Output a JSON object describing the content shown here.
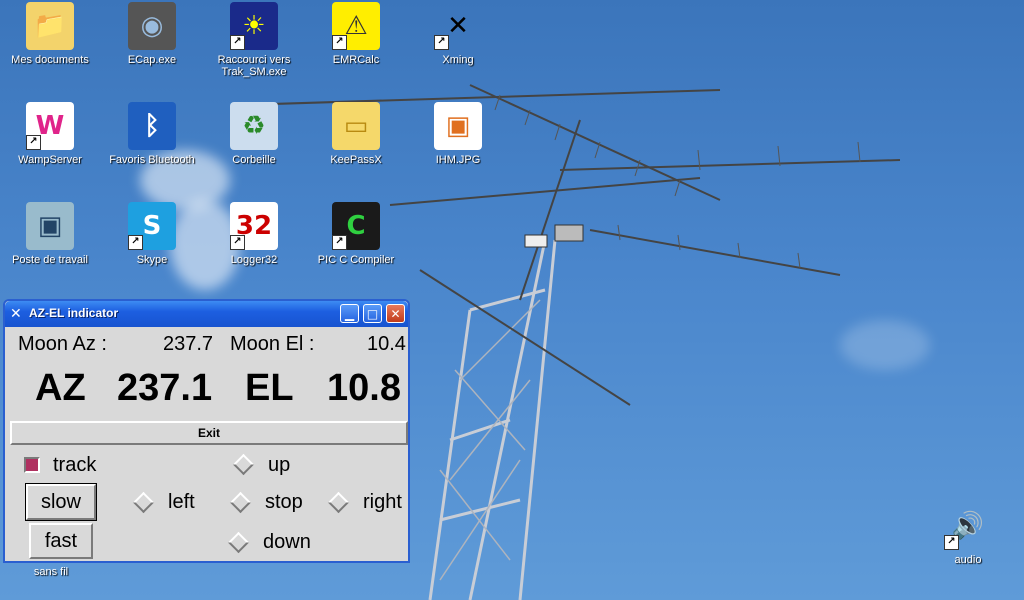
{
  "desktop": {
    "icons": [
      {
        "label": "Mes documents",
        "icon": "folder-documents-icon",
        "shortcut": false
      },
      {
        "label": "ECap.exe",
        "icon": "camera-icon",
        "shortcut": false
      },
      {
        "label": "Raccourci vers\nTrak_SM.exe",
        "icon": "trak-icon",
        "shortcut": true
      },
      {
        "label": "EMRCalc",
        "icon": "antenna-warning-icon",
        "shortcut": true
      },
      {
        "label": "Xming",
        "icon": "x-logo-icon",
        "shortcut": true
      },
      {
        "label": "WampServer",
        "icon": "wamp-icon",
        "shortcut": true
      },
      {
        "label": "Favoris Bluetooth",
        "icon": "bluetooth-icon",
        "shortcut": false
      },
      {
        "label": "Corbeille",
        "icon": "recycle-bin-icon",
        "shortcut": false
      },
      {
        "label": "KeePassX",
        "icon": "folder-icon",
        "shortcut": false
      },
      {
        "label": "IHM.JPG",
        "icon": "image-file-icon",
        "shortcut": false
      },
      {
        "label": "Poste de travail",
        "icon": "computer-icon",
        "shortcut": false
      },
      {
        "label": "Skype",
        "icon": "skype-icon",
        "shortcut": true
      },
      {
        "label": "Logger32",
        "icon": "logger-icon",
        "shortcut": true
      },
      {
        "label": "PIC C Compiler",
        "icon": "pic-compiler-icon",
        "shortcut": true
      },
      {
        "label": "audio",
        "icon": "speaker-icon",
        "shortcut": true
      }
    ],
    "partial_label": "sans fil"
  },
  "window": {
    "title": "AZ-EL indicator",
    "moon_az_label": "Moon Az :",
    "moon_az_value": "237.7",
    "moon_el_label": "Moon El :",
    "moon_el_value": "10.4",
    "az_label": "AZ",
    "az_value": "237.1",
    "el_label": "EL",
    "el_value": "10.8",
    "exit_label": "Exit",
    "track_label": "track",
    "up_label": "up",
    "left_label": "left",
    "stop_label": "stop",
    "right_label": "right",
    "down_label": "down",
    "slow_label": "slow",
    "fast_label": "fast"
  },
  "colors": {
    "track_checkbox": "#b03060",
    "titlebar": "#1d5fe0",
    "window_bg": "#d9d9d9"
  }
}
